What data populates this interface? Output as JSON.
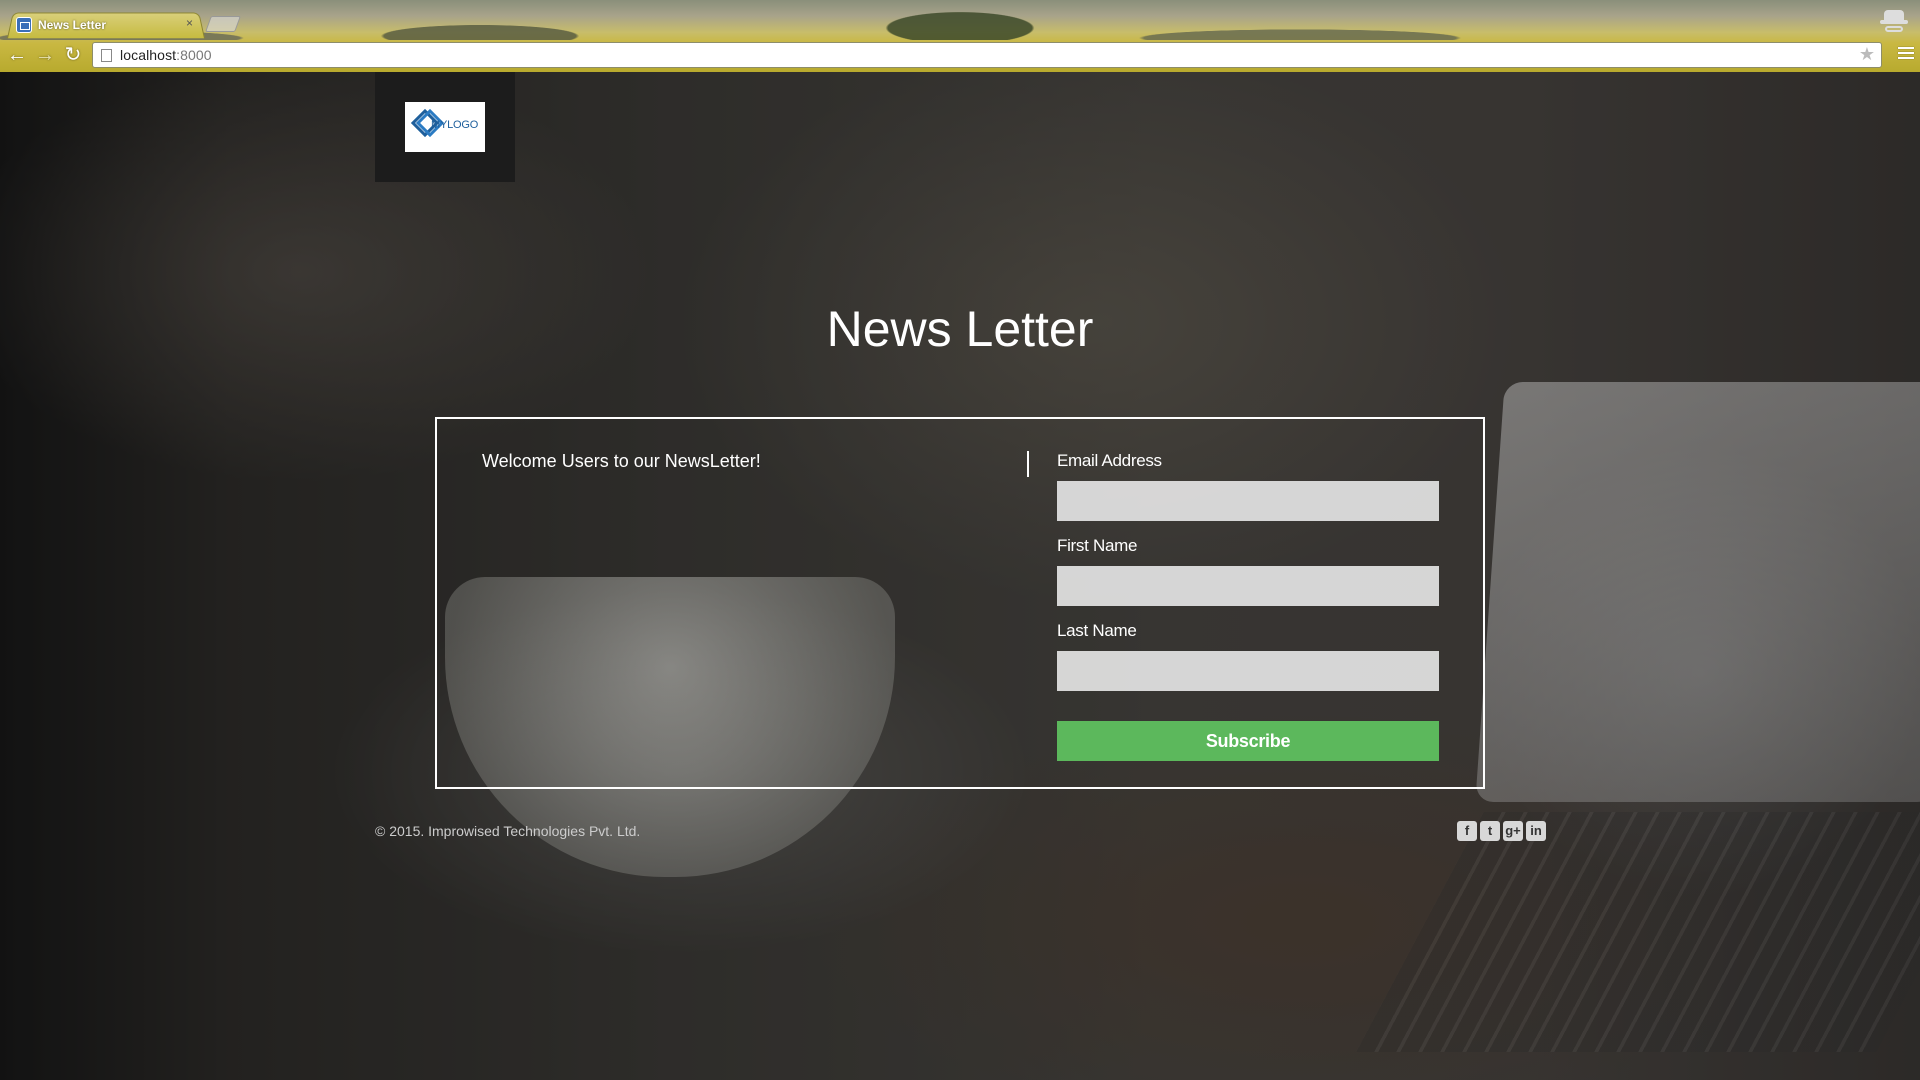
{
  "browser": {
    "tab_title": "News Letter",
    "tab_close": "×",
    "url_host": "localhost",
    "url_port": ":8000",
    "back_icon": "arrow-left-icon",
    "forward_icon": "arrow-right-icon",
    "reload_icon": "reload-icon",
    "star_icon": "bookmark-star-icon",
    "menu_icon": "hamburger-menu-icon"
  },
  "header": {
    "logo_text": "MYLOGO"
  },
  "main": {
    "title": "News Letter",
    "welcome": "Welcome Users to our NewsLetter!"
  },
  "form": {
    "email_label": "Email Address",
    "email_value": "",
    "first_name_label": "First Name",
    "first_name_value": "",
    "last_name_label": "Last Name",
    "last_name_value": "",
    "subscribe_label": "Subscribe",
    "button_color": "#5cb85c"
  },
  "footer": {
    "copyright": "© 2015. Improwised Technologies Pvt. Ltd.",
    "social": [
      {
        "icon": "facebook-icon",
        "glyph": "f"
      },
      {
        "icon": "twitter-icon",
        "glyph": "t"
      },
      {
        "icon": "google-plus-icon",
        "glyph": "g+"
      },
      {
        "icon": "linkedin-icon",
        "glyph": "in"
      }
    ]
  }
}
